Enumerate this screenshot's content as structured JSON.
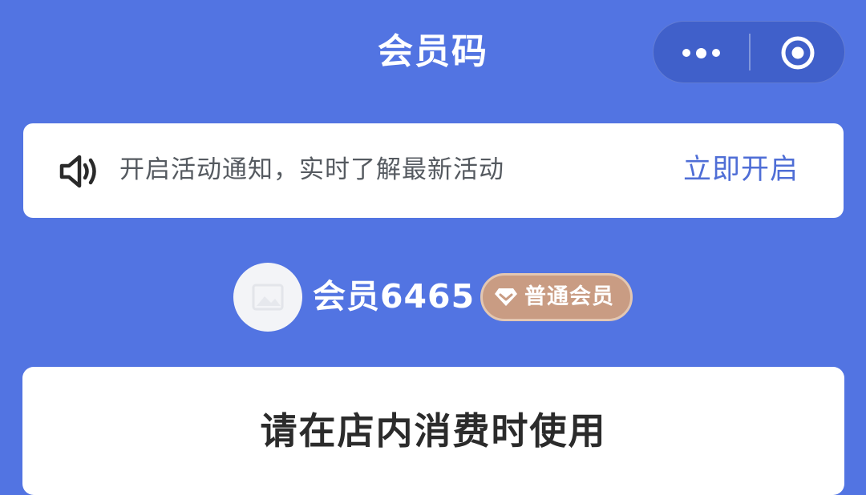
{
  "header": {
    "title": "会员码"
  },
  "capsule": {
    "more_icon": "more-dots-icon",
    "close_icon": "target-close-icon"
  },
  "notice": {
    "icon": "speaker-icon",
    "text": "开启活动通知，实时了解最新活动",
    "action_label": "立即开启",
    "action_color": "#4f6ed6"
  },
  "member": {
    "avatar_icon": "image-placeholder-icon",
    "name": "会员6465",
    "level_icon": "diamond-icon",
    "level": "普通会员",
    "level_color": "#c99c83"
  },
  "card": {
    "hint": "请在店内消费时使用"
  },
  "colors": {
    "background": "#5274e2",
    "card": "#ffffff"
  }
}
